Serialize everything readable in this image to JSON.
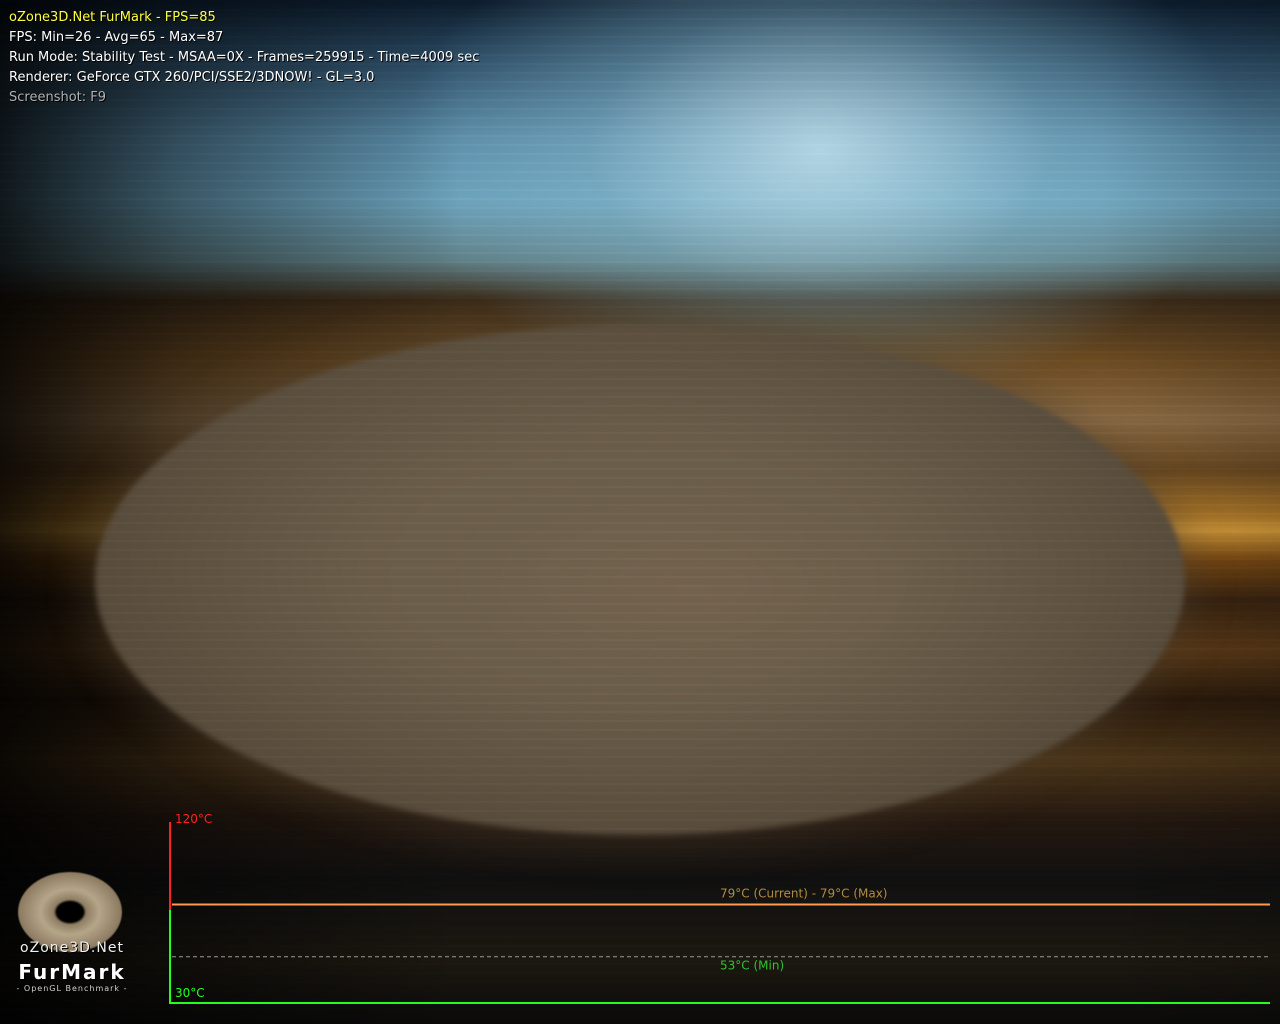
{
  "hud": {
    "title": "oZone3D.Net FurMark - FPS=85",
    "fps_stats": "FPS: Min=26 - Avg=65 - Max=87",
    "run_mode": "Run Mode: Stability Test - MSAA=0X - Frames=259915 - Time=4009 sec",
    "renderer": "Renderer: GeForce GTX 260/PCI/SSE2/3DNOW! - GL=3.0",
    "screenshot_hint": "Screenshot: F9"
  },
  "logo": {
    "site": "oZone3D.Net",
    "name": "FurMark",
    "subtitle": "- OpenGL Benchmark -"
  },
  "temperature_graph": {
    "max_label": "120°C",
    "min_label": "30°C",
    "scale_max_c": 120,
    "scale_min_c": 30,
    "current_c": 79,
    "max_c": 79,
    "min_c": 53,
    "current_max_label": "79°C (Current) - 79°C (Max)",
    "min_temp_label": "53°C (Min)",
    "colors": {
      "max_axis": "#ff2020",
      "min_axis": "#20ff20",
      "temperature_line": "#ff9a50",
      "current_label": "#b08a40",
      "min_label": "#30c030",
      "min_line": "#9a9a9a"
    }
  }
}
